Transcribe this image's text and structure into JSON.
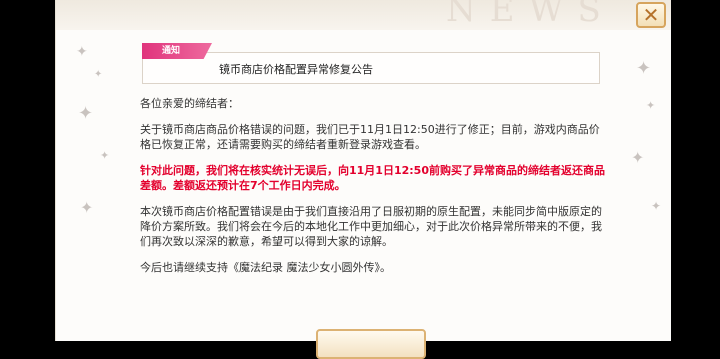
{
  "watermark": "NEWS",
  "close_icon": "close-x-icon",
  "notice": {
    "tag": "通知",
    "title": "镜币商店价格配置异常修复公告"
  },
  "body": {
    "greeting": "各位亲爱的缔结者：",
    "p1": "关于镜币商店商品价格错误的问题，我们已于11月1日12:50进行了修正；目前，游戏内商品价格已恢复正常，还请需要购买的缔结者重新登录游戏查看。",
    "p2_red": "针对此问题，我们将在核实统计无误后，向11月1日12:50前购买了异常商品的缔结者返还商品差额。差额返还预计在7个工作日内完成。",
    "p3": "本次镜币商店价格配置错误是由于我们直接沿用了日服初期的原生配置，未能同步简中版原定的降价方案所致。我们将会在今后的本地化工作中更加细心，对于此次价格异常所带来的不便，我们再次致以深深的歉意，希望可以得到大家的谅解。",
    "p4": "今后也请继续支持《魔法纪录 魔法少女小圆外传》。"
  },
  "colors": {
    "accent_pink": "#e0347c",
    "warning_red": "#e3002d",
    "gold_border": "#d6a45d"
  }
}
